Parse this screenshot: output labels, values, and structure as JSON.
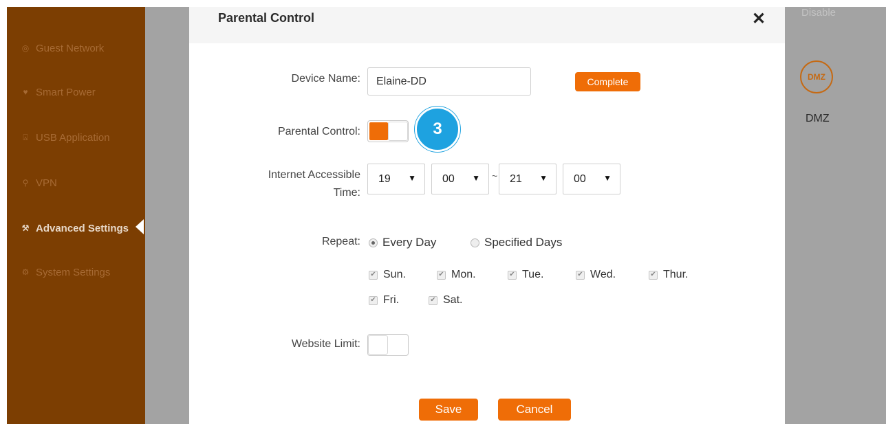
{
  "sidebar": {
    "items": [
      {
        "label": "Guest Network",
        "icon": "globe-icon",
        "glyph": "◎"
      },
      {
        "label": "Smart Power",
        "icon": "power-leaf-icon",
        "glyph": "♥"
      },
      {
        "label": "USB Application",
        "icon": "usb-icon",
        "glyph": "⍓"
      },
      {
        "label": "VPN",
        "icon": "vpn-icon",
        "glyph": "⚲"
      },
      {
        "label": "Advanced Settings",
        "icon": "wrench-icon",
        "glyph": "⚒"
      },
      {
        "label": "System Settings",
        "icon": "gear-icon",
        "glyph": "⚙"
      }
    ],
    "active_index": 4
  },
  "background": {
    "disable_text": "Disable",
    "dmz_icon_text": "DMZ",
    "dmz_label": "DMZ"
  },
  "dialog": {
    "title": "Parental Control",
    "close_glyph": "✕",
    "device_name_label": "Device Name:",
    "device_name_value": "Elaine-DD",
    "complete_label": "Complete",
    "parental_control_label": "Parental Control:",
    "parental_control_on": true,
    "step_number": "3",
    "access_time_label_line1": "Internet Accessible",
    "access_time_label_line2": "Time:",
    "time": {
      "start_hour": "19",
      "start_minute": "00",
      "separator": "~",
      "end_hour": "21",
      "end_minute": "00"
    },
    "caret_glyph": "▼",
    "repeat_label": "Repeat:",
    "repeat_options": [
      "Every Day",
      "Specified Days"
    ],
    "repeat_selected": "Every Day",
    "days": [
      "Sun.",
      "Mon.",
      "Tue.",
      "Wed.",
      "Thur.",
      "Fri.",
      "Sat."
    ],
    "check_glyph": "✔",
    "website_limit_label": "Website Limit:",
    "website_limit_on": false,
    "save_label": "Save",
    "cancel_label": "Cancel"
  },
  "colors": {
    "sidebar_bg": "#7c3e02",
    "accent": "#ef6d07",
    "badge": "#1ea2e0",
    "overlay_gray": "#a3a3a3"
  }
}
